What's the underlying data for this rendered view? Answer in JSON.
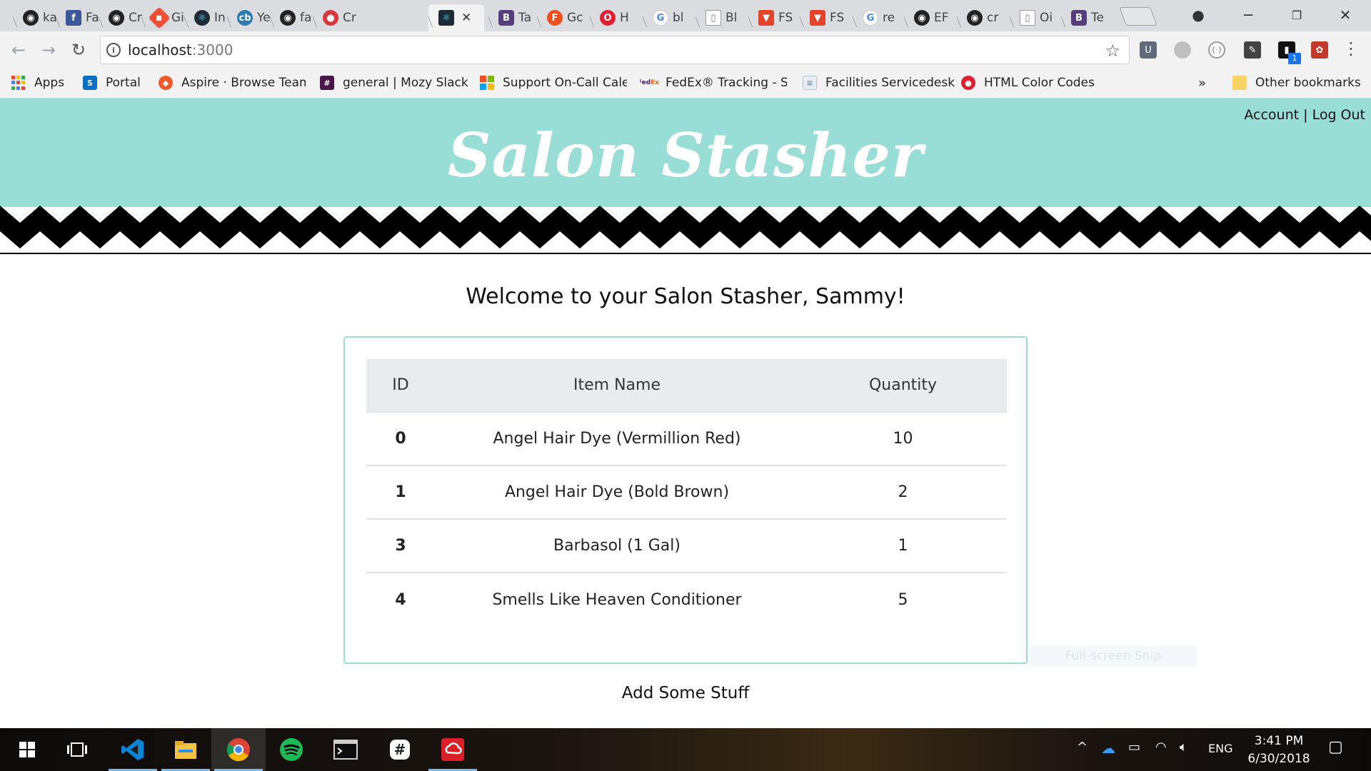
{
  "browser": {
    "tabs": [
      {
        "label": "ka",
        "icon": "github-icon",
        "color": "#222222"
      },
      {
        "label": "Fa",
        "icon": "facebook-icon",
        "color": "#3b5998"
      },
      {
        "label": "Cr",
        "icon": "github-icon",
        "color": "#222222"
      },
      {
        "label": "Gi",
        "icon": "git-icon",
        "color": "#f05033"
      },
      {
        "label": "In",
        "icon": "react-icon",
        "color": "#1d2b36"
      },
      {
        "label": "Ye",
        "icon": "cb-icon",
        "color": "#2a7ab0"
      },
      {
        "label": "fa",
        "icon": "github-icon",
        "color": "#222222"
      },
      {
        "label": "Cr",
        "icon": "tomato-icon",
        "color": "#d9363e"
      },
      {
        "label": "",
        "icon": "react-icon",
        "color": "#1d2b36",
        "active": true
      },
      {
        "label": "Ta",
        "icon": "bootstrap-icon",
        "color": "#563d7c"
      },
      {
        "label": "Gc",
        "icon": "f-icon",
        "color": "#f24e1e"
      },
      {
        "label": "H",
        "icon": "opera-icon",
        "color": "#e0202e"
      },
      {
        "label": "bl",
        "icon": "google-icon",
        "color": "#4285f4"
      },
      {
        "label": "Bl",
        "icon": "page-icon",
        "color": "#9aa0a6"
      },
      {
        "label": "FS",
        "icon": "gitlab-icon",
        "color": "#e24329"
      },
      {
        "label": "FS",
        "icon": "gitlab-icon",
        "color": "#e24329"
      },
      {
        "label": "re",
        "icon": "google-icon",
        "color": "#4285f4"
      },
      {
        "label": "EF",
        "icon": "github-icon",
        "color": "#222222"
      },
      {
        "label": "cr",
        "icon": "github-icon",
        "color": "#222222"
      },
      {
        "label": "Oi",
        "icon": "page-icon",
        "color": "#9aa0a6"
      },
      {
        "label": "Te",
        "icon": "bootstrap-icon",
        "color": "#563d7c"
      }
    ],
    "active_tab_close": "✕",
    "url_host": "localhost",
    "url_port": ":3000",
    "bookmarks": [
      {
        "label": "Apps",
        "icon": "apps-grid-icon"
      },
      {
        "label": "Portal",
        "icon": "sharepoint-icon",
        "color": "#0b6fc4"
      },
      {
        "label": "Aspire · Browse Team",
        "icon": "aspire-icon",
        "color": "#f05a28"
      },
      {
        "label": "general | Mozy Slack",
        "icon": "slack-icon",
        "color": "#4a154b"
      },
      {
        "label": "Support On-Call Cale",
        "icon": "microsoft-icon",
        "color": "#f25022"
      },
      {
        "label": "FedEx® Tracking - Si",
        "icon": "fedex-icon",
        "color": "#4d148c"
      },
      {
        "label": "Facilities Servicedesk",
        "icon": "document-icon",
        "color": "#7a8ca3"
      },
      {
        "label": "HTML Color Codes",
        "icon": "colorcodes-icon",
        "color": "#e0202e"
      }
    ],
    "bookmarks_overflow": "»",
    "other_bookmarks": "Other bookmarks",
    "extension_badge": "1"
  },
  "header": {
    "title": "Salon Stasher",
    "account_link": "Account",
    "separator": "|",
    "logout_link": "Log Out",
    "color": "#98ddd6"
  },
  "main": {
    "welcome": "Welcome to your Salon Stasher, Sammy!",
    "table": {
      "columns": [
        "ID",
        "Item Name",
        "Quantity"
      ],
      "rows": [
        {
          "id": "0",
          "name": "Angel Hair Dye (Vermillion Red)",
          "quantity": "10"
        },
        {
          "id": "1",
          "name": "Angel Hair Dye (Bold Brown)",
          "quantity": "2"
        },
        {
          "id": "3",
          "name": "Barbasol (1 Gal)",
          "quantity": "1"
        },
        {
          "id": "4",
          "name": "Smells Like Heaven Conditioner",
          "quantity": "5"
        }
      ]
    },
    "add_link": "Add Some Stuff",
    "snip_overlay": "Full-screen Snip"
  },
  "taskbar": {
    "apps": [
      "windows-start-icon",
      "task-view-icon",
      "vscode-icon",
      "file-explorer-icon",
      "chrome-icon",
      "spotify-icon",
      "terminal-icon",
      "slack-icon",
      "creative-cloud-icon"
    ],
    "language": "ENG",
    "time": "3:41 PM",
    "date": "6/30/2018"
  }
}
